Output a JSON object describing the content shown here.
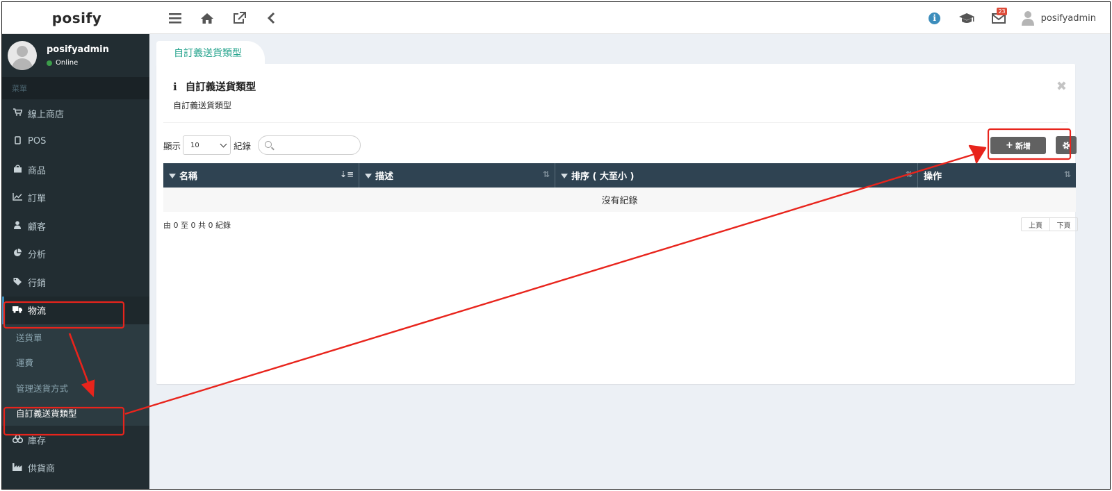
{
  "app": {
    "logo_text": "posify"
  },
  "topbar": {
    "left_icons": [
      "menu-icon",
      "home-icon",
      "external-link-icon",
      "back-arrow-icon"
    ],
    "info_icon": "i",
    "mail_badge": "23",
    "username": "posifyadmin"
  },
  "sidebar": {
    "user": {
      "name": "posifyadmin",
      "status": "Online"
    },
    "menu_header": "菜單",
    "items": [
      {
        "label": "線上商店",
        "icon": "cart-icon"
      },
      {
        "label": "POS",
        "icon": "tablet-icon"
      },
      {
        "label": "商品",
        "icon": "bag-icon"
      },
      {
        "label": "訂單",
        "icon": "chart-line-icon"
      },
      {
        "label": "顧客",
        "icon": "user-icon"
      },
      {
        "label": "分析",
        "icon": "pie-chart-icon"
      },
      {
        "label": "行銷",
        "icon": "tags-icon"
      },
      {
        "label": "物流",
        "icon": "truck-icon"
      }
    ],
    "sub_items": [
      {
        "label": "送貨單"
      },
      {
        "label": "運費"
      },
      {
        "label": "管理送貨方式"
      },
      {
        "label": "自訂義送貨類型"
      }
    ],
    "items_after": [
      {
        "label": "庫存",
        "icon": "cubes-icon"
      },
      {
        "label": "供貨商",
        "icon": "industry-icon"
      }
    ]
  },
  "main": {
    "tab_label": "自訂義送貨類型",
    "title": "自訂義送貨類型",
    "subtitle": "自訂義送貨類型",
    "show_label": "顯示",
    "page_length": "10",
    "records_label": "紀錄",
    "search_placeholder": "",
    "new_button_label": "新增",
    "table": {
      "columns": [
        {
          "label": "名稱"
        },
        {
          "label": "描述"
        },
        {
          "label": "排序 ( 大至小 )"
        },
        {
          "label": "操作"
        }
      ],
      "empty_text": "沒有紀錄"
    },
    "info_text": "由 0 至 0 共 0 紀錄",
    "pager": {
      "prev": "上頁",
      "next": "下頁"
    }
  },
  "colors": {
    "sidebar_bg": "#222d32",
    "table_header_bg": "#2f4352",
    "tab_text": "#27a48e",
    "button_bg": "#616161",
    "annotation_red": "#e8241c",
    "info_blue": "#3c8dbc"
  }
}
